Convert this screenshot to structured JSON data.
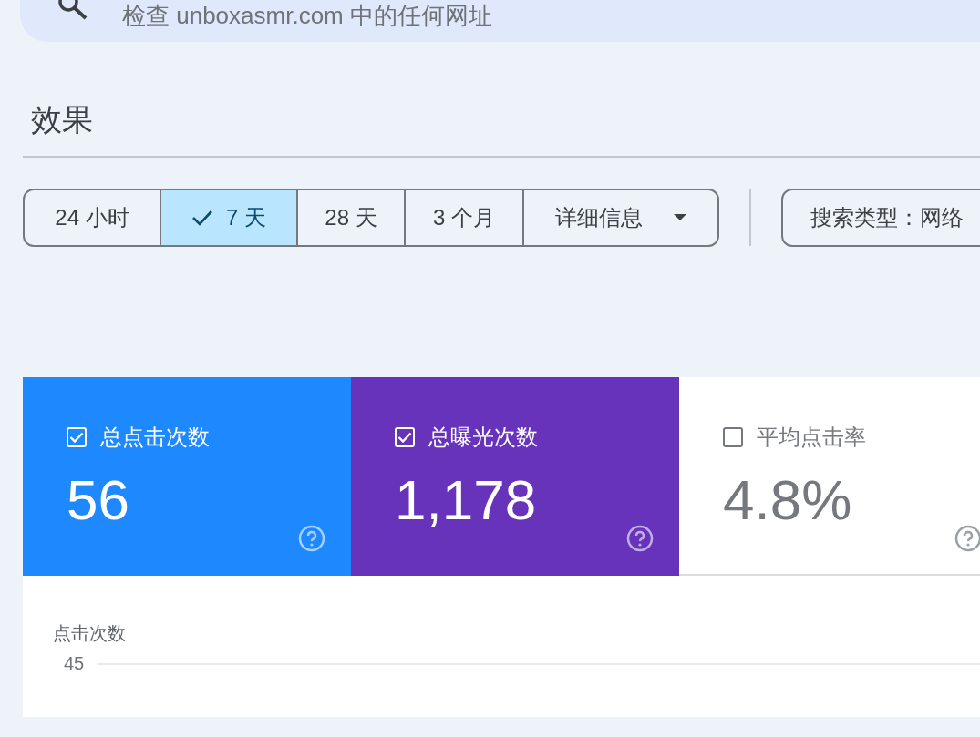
{
  "search": {
    "placeholder": "检查 unboxasmr.com 中的任何网址"
  },
  "title": "效果",
  "date_ranges": [
    {
      "label": "24 小时",
      "selected": false,
      "kind": "option"
    },
    {
      "label": "7 天",
      "selected": true,
      "kind": "option"
    },
    {
      "label": "28 天",
      "selected": false,
      "kind": "option"
    },
    {
      "label": "3 个月",
      "selected": false,
      "kind": "option"
    },
    {
      "label": "详细信息",
      "selected": false,
      "kind": "dropdown"
    }
  ],
  "filter_chip": {
    "label": "搜索类型：网络"
  },
  "metrics": [
    {
      "label": "总点击次数",
      "value": "56",
      "checked": true,
      "color": "#1e88ff"
    },
    {
      "label": "总曝光次数",
      "value": "1,178",
      "checked": true,
      "color": "#6733bb"
    },
    {
      "label": "平均点击率",
      "value": "4.8%",
      "checked": false
    }
  ],
  "chart": {
    "axis_title": "点击次数",
    "tick_label": "45"
  }
}
